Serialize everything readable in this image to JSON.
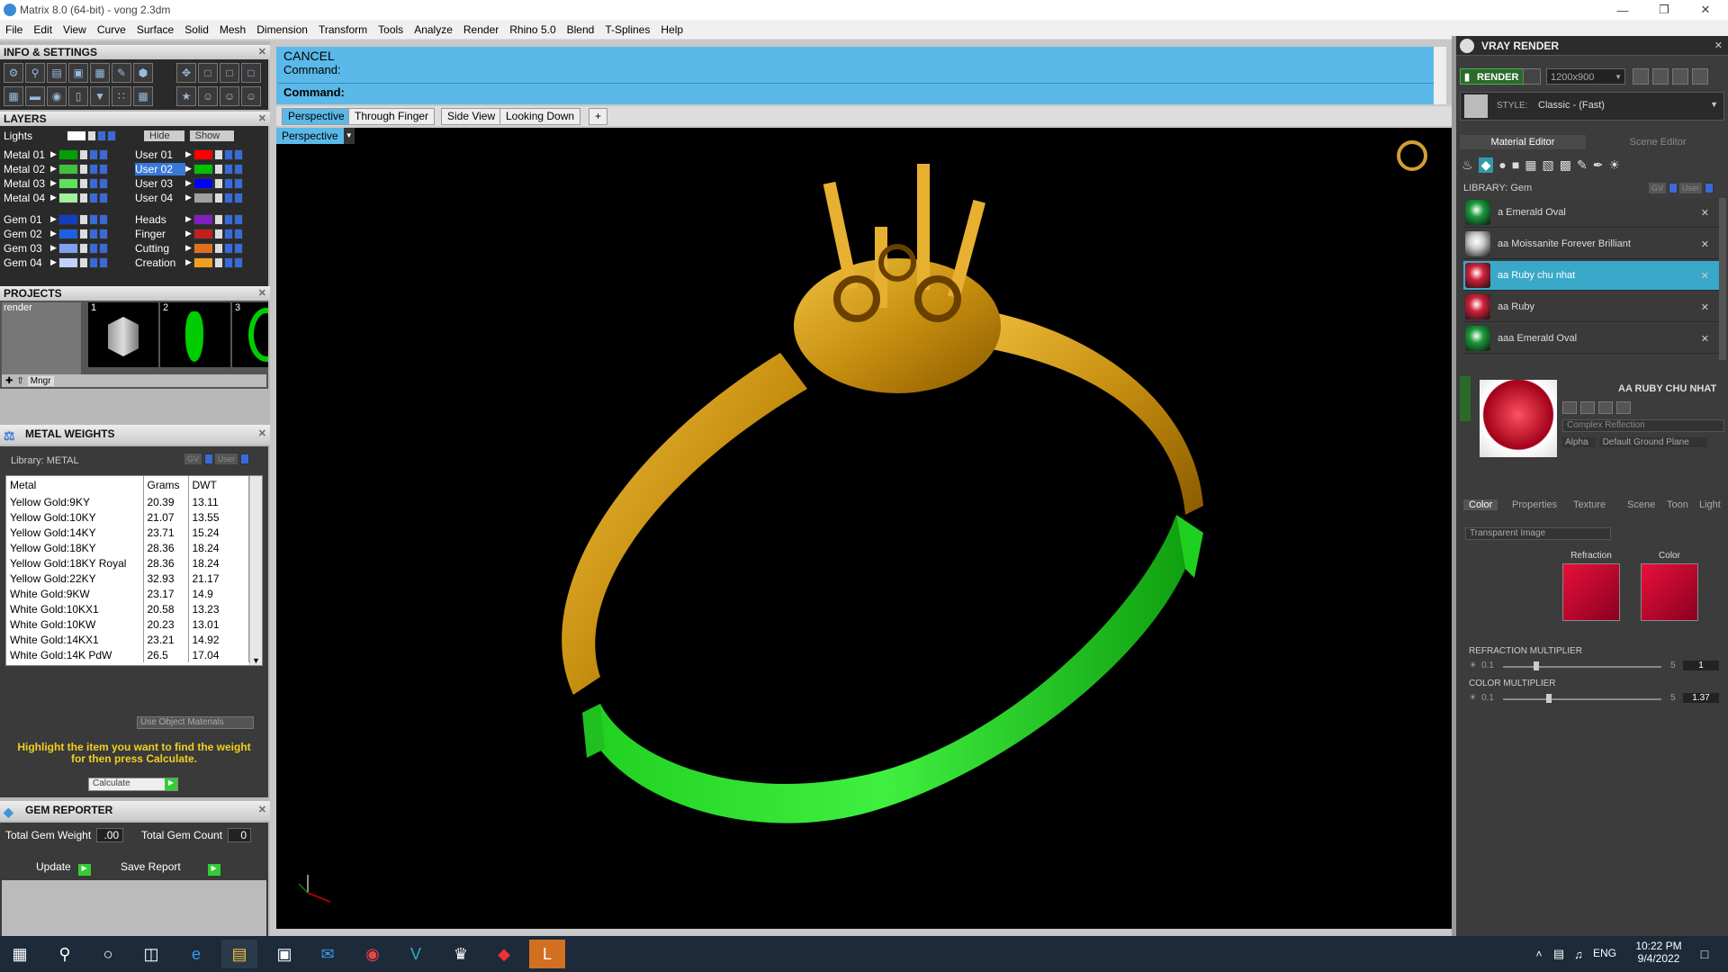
{
  "window": {
    "title": "Matrix 8.0 (64-bit) - vong 2.3dm"
  },
  "menu": [
    "File",
    "Edit",
    "View",
    "Curve",
    "Surface",
    "Solid",
    "Mesh",
    "Dimension",
    "Transform",
    "Tools",
    "Analyze",
    "Render",
    "Rhino 5.0",
    "Blend",
    "T-Splines",
    "Help"
  ],
  "info_settings": {
    "title": "INFO & SETTINGS"
  },
  "layers": {
    "title": "LAYERS",
    "lights_label": "Lights",
    "hide_label": "Hide",
    "show_label": "Show",
    "left": [
      {
        "name": "Metal 01",
        "color": "#00a000"
      },
      {
        "name": "Metal 02",
        "color": "#40c040"
      },
      {
        "name": "Metal 03",
        "color": "#60e060"
      },
      {
        "name": "Metal 04",
        "color": "#a0f0a0"
      },
      {
        "name": "Gem 01",
        "color": "#1040c0"
      },
      {
        "name": "Gem 02",
        "color": "#2060e0"
      },
      {
        "name": "Gem 03",
        "color": "#80a0f0"
      },
      {
        "name": "Gem 04",
        "color": "#c0d0ff"
      }
    ],
    "right": [
      {
        "name": "User 01",
        "color": "#ff0000"
      },
      {
        "name": "User 02",
        "color": "#00c000"
      },
      {
        "name": "User 03",
        "color": "#0000ff"
      },
      {
        "name": "User 04",
        "color": "#a0a0a0"
      },
      {
        "name": "Heads",
        "color": "#8020c0"
      },
      {
        "name": "Finger",
        "color": "#c02020"
      },
      {
        "name": "Cutting",
        "color": "#e07020"
      },
      {
        "name": "Creation",
        "color": "#f0a020"
      }
    ]
  },
  "projects": {
    "title": "PROJECTS",
    "item": "render",
    "thumbs": [
      "1",
      "2",
      "3"
    ],
    "mngr_label": "Mngr"
  },
  "metal_weights": {
    "title": "METAL WEIGHTS",
    "library": "Library: METAL",
    "gv_label": "GV",
    "user_label": "User",
    "columns": [
      "Metal",
      "Grams",
      "DWT"
    ],
    "rows": [
      [
        "Yellow Gold:9KY",
        "20.39",
        "13.11"
      ],
      [
        "Yellow Gold:10KY",
        "21.07",
        "13.55"
      ],
      [
        "Yellow Gold:14KY",
        "23.71",
        "15.24"
      ],
      [
        "Yellow Gold:18KY",
        "28.36",
        "18.24"
      ],
      [
        "Yellow Gold:18KY Royal",
        "28.36",
        "18.24"
      ],
      [
        "Yellow Gold:22KY",
        "32.93",
        "21.17"
      ],
      [
        "White Gold:9KW",
        "23.17",
        "14.9"
      ],
      [
        "White Gold:10KX1",
        "20.58",
        "13.23"
      ],
      [
        "White Gold:10KW",
        "20.23",
        "13.01"
      ],
      [
        "White Gold:14KX1",
        "23.21",
        "14.92"
      ],
      [
        "White Gold:14K PdW",
        "26.5",
        "17.04"
      ]
    ],
    "use_object_materials": "Use Object Materials",
    "hint": "Highlight the item you want to find the weight for then press Calculate.",
    "calculate_label": "Calculate"
  },
  "gem_reporter": {
    "title": "GEM REPORTER",
    "total_weight_label": "Total Gem Weight",
    "total_weight_value": ".00",
    "total_count_label": "Total Gem Count",
    "total_count_value": "0",
    "update_label": "Update",
    "save_report_label": "Save Report"
  },
  "command": {
    "cancel": "CANCEL",
    "line1": "Command:",
    "prompt": "Command:"
  },
  "view_tabs": [
    "Perspective",
    "Through Finger",
    "Side View",
    "Looking Down",
    "+"
  ],
  "viewport_label": "Perspective",
  "vray": {
    "title": "VRAY RENDER",
    "render_label": "RENDER",
    "resolution": "1200x900",
    "style_label": "STYLE:",
    "style_value": "Classic - (Fast)",
    "tabs": [
      "Material Editor",
      "Scene Editor"
    ],
    "library_label": "LIBRARY: Gem",
    "gv_label": "GV",
    "user_label": "User",
    "library_items": [
      {
        "name": "a Emerald Oval",
        "color": "#1a9a3a"
      },
      {
        "name": "aa Moissanite Forever Brilliant",
        "color": "#cccccc"
      },
      {
        "name": "aa Ruby chu nhat",
        "color": "#d0203a"
      },
      {
        "name": "aa Ruby",
        "color": "#d0203a"
      },
      {
        "name": "aaa Emerald Oval",
        "color": "#1a9a3a"
      }
    ],
    "selected_material": "AA RUBY CHU NHAT",
    "complex_reflection": "Complex Reflection",
    "alpha_label": "Alpha",
    "ground_plane": "Default Ground Plane",
    "prop_tabs": [
      "Color",
      "Properties",
      "Texture",
      "Scene",
      "Toon",
      "Light"
    ],
    "transparent_image": "Transparent Image",
    "refraction_label": "Refraction",
    "color_label": "Color",
    "swatch_color": "#e8103a",
    "refraction_multiplier": {
      "label": "REFRACTION MULTIPLIER",
      "min": "0.1",
      "max": "5",
      "value": "1"
    },
    "color_multiplier": {
      "label": "COLOR MULTIPLIER",
      "min": "0.1",
      "max": "5",
      "value": "1.37"
    }
  },
  "taskbar": {
    "lang": "ENG",
    "time": "10:22 PM",
    "date": "9/4/2022"
  }
}
